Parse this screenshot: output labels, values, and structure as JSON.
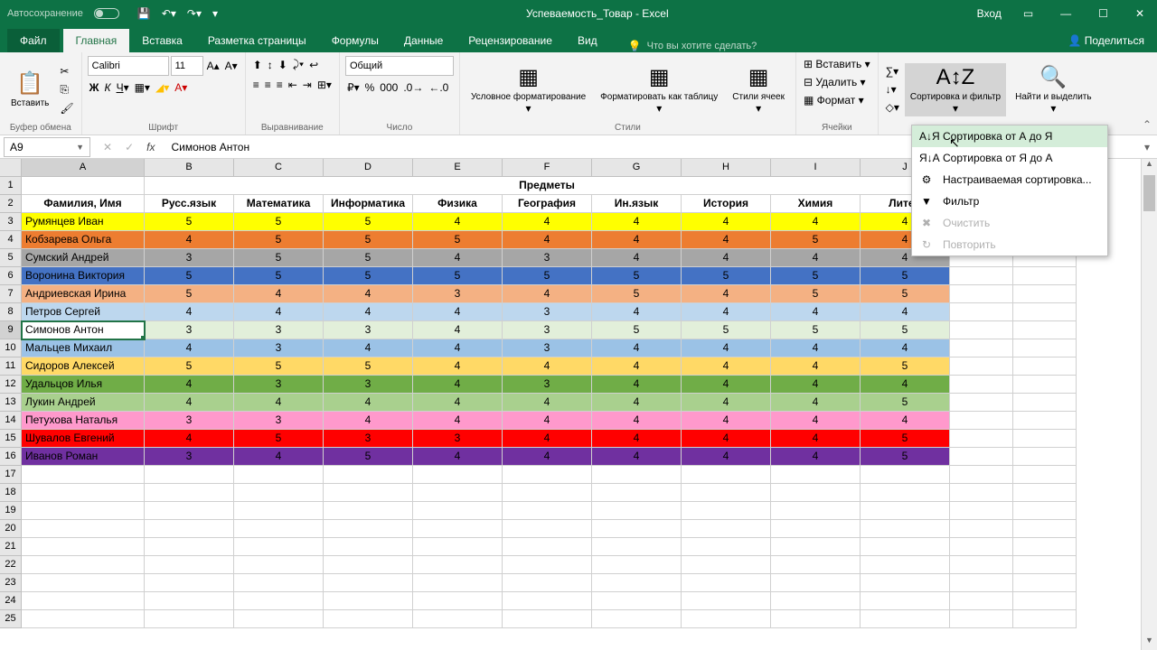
{
  "title": "Успеваемость_Товар - Excel",
  "autosave": "Автосохранение",
  "login": "Вход",
  "tabs": {
    "file": "Файл",
    "home": "Главная",
    "insert": "Вставка",
    "layout": "Разметка страницы",
    "formulas": "Формулы",
    "data": "Данные",
    "review": "Рецензирование",
    "view": "Вид",
    "tellme": "Что вы хотите сделать?",
    "share": "Поделиться"
  },
  "ribbon": {
    "clipboard": "Буфер обмена",
    "paste": "Вставить",
    "font_group": "Шрифт",
    "font_name": "Calibri",
    "font_size": "11",
    "align_group": "Выравнивание",
    "number_group": "Число",
    "number_format": "Общий",
    "styles_group": "Стили",
    "cond_fmt": "Условное форматирование",
    "fmt_table": "Форматировать как таблицу",
    "cell_styles": "Стили ячеек",
    "cells_group": "Ячейки",
    "insert_cells": "Вставить",
    "delete_cells": "Удалить",
    "format": "Формат",
    "sort_filter": "Сортировка и фильтр",
    "find_select": "Найти и выделить"
  },
  "dropdown": {
    "sort_az": "Сортировка от А до Я",
    "sort_za": "Сортировка от Я до А",
    "custom_sort": "Настраиваемая сортировка...",
    "filter": "Фильтр",
    "clear": "Очистить",
    "reapply": "Повторить"
  },
  "namebox": "A9",
  "formula_value": "Симонов Антон",
  "cols": [
    "A",
    "B",
    "C",
    "D",
    "E",
    "F",
    "G",
    "H",
    "I",
    "J",
    "K",
    "L"
  ],
  "table": {
    "subjects_header": "Предметы",
    "headers": [
      "Фамилия, Имя",
      "Русс.язык",
      "Математика",
      "Информатика",
      "Физика",
      "География",
      "Ин.язык",
      "История",
      "Химия",
      "Литер"
    ],
    "rows": [
      {
        "c": "r-yellow",
        "d": [
          "Румянцев Иван",
          "5",
          "5",
          "5",
          "4",
          "4",
          "4",
          "4",
          "4",
          "4"
        ]
      },
      {
        "c": "r-orange",
        "d": [
          "Кобзарева Ольга",
          "4",
          "5",
          "5",
          "5",
          "4",
          "4",
          "4",
          "5",
          "4"
        ]
      },
      {
        "c": "r-gray",
        "d": [
          "Сумский Андрей",
          "3",
          "5",
          "5",
          "4",
          "3",
          "4",
          "4",
          "4",
          "4"
        ]
      },
      {
        "c": "r-blue",
        "d": [
          "Воронина Виктория",
          "5",
          "5",
          "5",
          "5",
          "5",
          "5",
          "5",
          "5",
          "5"
        ]
      },
      {
        "c": "r-peach",
        "d": [
          "Андриевская Ирина",
          "5",
          "4",
          "4",
          "3",
          "4",
          "5",
          "4",
          "5",
          "5"
        ]
      },
      {
        "c": "r-paleblue",
        "d": [
          "Петров Сергей",
          "4",
          "4",
          "4",
          "4",
          "3",
          "4",
          "4",
          "4",
          "4"
        ]
      },
      {
        "c": "r-palegreen",
        "d": [
          "Симонов Антон",
          "3",
          "3",
          "3",
          "4",
          "3",
          "5",
          "5",
          "5",
          "5"
        ]
      },
      {
        "c": "r-lightblue",
        "d": [
          "Мальцев Михаил",
          "4",
          "3",
          "4",
          "4",
          "3",
          "4",
          "4",
          "4",
          "4"
        ]
      },
      {
        "c": "r-gold",
        "d": [
          "Сидоров Алексей",
          "5",
          "5",
          "5",
          "4",
          "4",
          "4",
          "4",
          "4",
          "5"
        ]
      },
      {
        "c": "r-green",
        "d": [
          "Удальцов Илья",
          "4",
          "3",
          "3",
          "4",
          "3",
          "4",
          "4",
          "4",
          "4"
        ]
      },
      {
        "c": "r-lime",
        "d": [
          "Лукин Андрей",
          "4",
          "4",
          "4",
          "4",
          "4",
          "4",
          "4",
          "4",
          "5"
        ]
      },
      {
        "c": "r-pink",
        "d": [
          "Петухова Наталья",
          "3",
          "3",
          "4",
          "4",
          "4",
          "4",
          "4",
          "4",
          "4"
        ]
      },
      {
        "c": "r-red",
        "d": [
          "Шувалов Евгений",
          "4",
          "5",
          "3",
          "3",
          "4",
          "4",
          "4",
          "4",
          "5"
        ]
      },
      {
        "c": "r-purple",
        "d": [
          "Иванов Роман",
          "3",
          "4",
          "5",
          "4",
          "4",
          "4",
          "4",
          "4",
          "5"
        ]
      }
    ]
  }
}
